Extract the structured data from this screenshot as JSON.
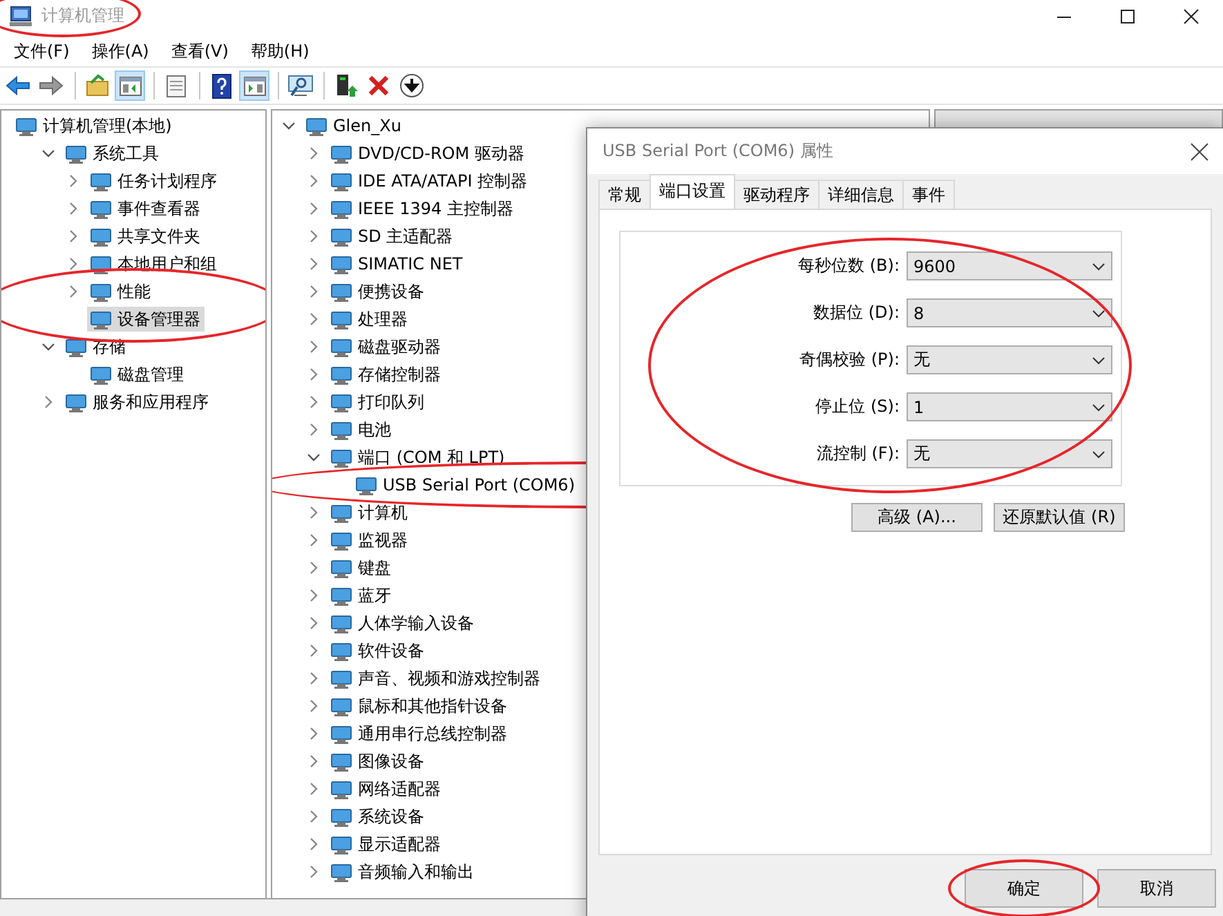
{
  "window": {
    "title": "计算机管理",
    "annotated": true
  },
  "menu": [
    "文件(F)",
    "操作(A)",
    "查看(V)",
    "帮助(H)"
  ],
  "toolbar": [
    {
      "kind": "back",
      "pressed": false
    },
    {
      "kind": "forward",
      "pressed": false
    },
    {
      "kind": "separator"
    },
    {
      "kind": "up",
      "pressed": false
    },
    {
      "kind": "tree",
      "pressed": true
    },
    {
      "kind": "separator"
    },
    {
      "kind": "properties",
      "pressed": false
    },
    {
      "kind": "separator"
    },
    {
      "kind": "help",
      "pressed": false
    },
    {
      "kind": "actions",
      "pressed": true
    },
    {
      "kind": "separator"
    },
    {
      "kind": "scan",
      "pressed": false
    },
    {
      "kind": "separator"
    },
    {
      "kind": "enable",
      "pressed": false
    },
    {
      "kind": "delete",
      "pressed": false
    },
    {
      "kind": "update",
      "pressed": false
    }
  ],
  "console_tree": {
    "items": [
      {
        "label": "计算机管理(本地)",
        "selected": false,
        "children": [
          {
            "label": "系统工具",
            "expanded": true,
            "selected": false,
            "children": [
              {
                "label": "任务计划程序",
                "expanded": false,
                "selected": false
              },
              {
                "label": "事件查看器",
                "expanded": false,
                "selected": false
              },
              {
                "label": "共享文件夹",
                "expanded": false,
                "selected": false
              },
              {
                "label": "本地用户和组",
                "expanded": false,
                "selected": false
              },
              {
                "label": "性能",
                "expanded": false,
                "selected": false,
                "annotated": true
              },
              {
                "label": "设备管理器",
                "selected": true,
                "annotated": true
              }
            ]
          },
          {
            "label": "存储",
            "expanded": true,
            "selected": false,
            "children": [
              {
                "label": "磁盘管理",
                "selected": false
              }
            ]
          },
          {
            "label": "服务和应用程序",
            "expanded": false,
            "selected": false
          }
        ]
      }
    ]
  },
  "device_tree": {
    "items": [
      {
        "label": "Glen_Xu",
        "expanded": true,
        "selected": false,
        "children": [
          {
            "label": "DVD/CD-ROM 驱动器",
            "expanded": false,
            "selected": false
          },
          {
            "label": "IDE ATA/ATAPI 控制器",
            "expanded": false,
            "selected": false
          },
          {
            "label": "IEEE 1394 主控制器",
            "expanded": false,
            "selected": false
          },
          {
            "label": "SD 主适配器",
            "expanded": false,
            "selected": false
          },
          {
            "label": "SIMATIC NET",
            "expanded": false,
            "selected": false
          },
          {
            "label": "便携设备",
            "expanded": false,
            "selected": false
          },
          {
            "label": "处理器",
            "expanded": false,
            "selected": false
          },
          {
            "label": "磁盘驱动器",
            "expanded": false,
            "selected": false
          },
          {
            "label": "存储控制器",
            "expanded": false,
            "selected": false
          },
          {
            "label": "打印队列",
            "expanded": false,
            "selected": false
          },
          {
            "label": "电池",
            "expanded": false,
            "selected": false
          },
          {
            "label": "端口 (COM 和 LPT)",
            "expanded": true,
            "selected": false,
            "children": [
              {
                "label": "USB Serial Port (COM6)",
                "selected": false,
                "annotated": true
              }
            ]
          },
          {
            "label": "计算机",
            "expanded": false,
            "selected": false
          },
          {
            "label": "监视器",
            "expanded": false,
            "selected": false
          },
          {
            "label": "键盘",
            "expanded": false,
            "selected": false
          },
          {
            "label": "蓝牙",
            "expanded": false,
            "selected": false
          },
          {
            "label": "人体学输入设备",
            "expanded": false,
            "selected": false
          },
          {
            "label": "软件设备",
            "expanded": false,
            "selected": false
          },
          {
            "label": "声音、视频和游戏控制器",
            "expanded": false,
            "selected": false
          },
          {
            "label": "鼠标和其他指针设备",
            "expanded": false,
            "selected": false
          },
          {
            "label": "通用串行总线控制器",
            "expanded": false,
            "selected": false
          },
          {
            "label": "图像设备",
            "expanded": false,
            "selected": false
          },
          {
            "label": "网络适配器",
            "expanded": false,
            "selected": false
          },
          {
            "label": "系统设备",
            "expanded": false,
            "selected": false
          },
          {
            "label": "显示适配器",
            "expanded": false,
            "selected": false
          },
          {
            "label": "音频输入和输出",
            "expanded": false,
            "selected": false
          }
        ]
      }
    ]
  },
  "dialog": {
    "title": "USB Serial Port (COM6) 属性",
    "tabs": [
      {
        "label": "常规",
        "selected": false
      },
      {
        "label": "端口设置",
        "selected": true
      },
      {
        "label": "驱动程序",
        "selected": false
      },
      {
        "label": "详细信息",
        "selected": false
      },
      {
        "label": "事件",
        "selected": false
      }
    ],
    "port_settings": {
      "annotated": true,
      "fields": [
        {
          "label": "每秒位数 (B):",
          "value": "9600"
        },
        {
          "label": "数据位 (D):",
          "value": "8"
        },
        {
          "label": "奇偶校验 (P):",
          "value": "无"
        },
        {
          "label": "停止位 (S):",
          "value": "1"
        },
        {
          "label": "流控制 (F):",
          "value": "无"
        }
      ]
    },
    "buttons": [
      "高级 (A)...",
      "还原默认值 (R)"
    ],
    "footer_buttons": [
      {
        "label": "确定",
        "annotated": true
      },
      {
        "label": "取消",
        "annotated": false
      }
    ]
  }
}
